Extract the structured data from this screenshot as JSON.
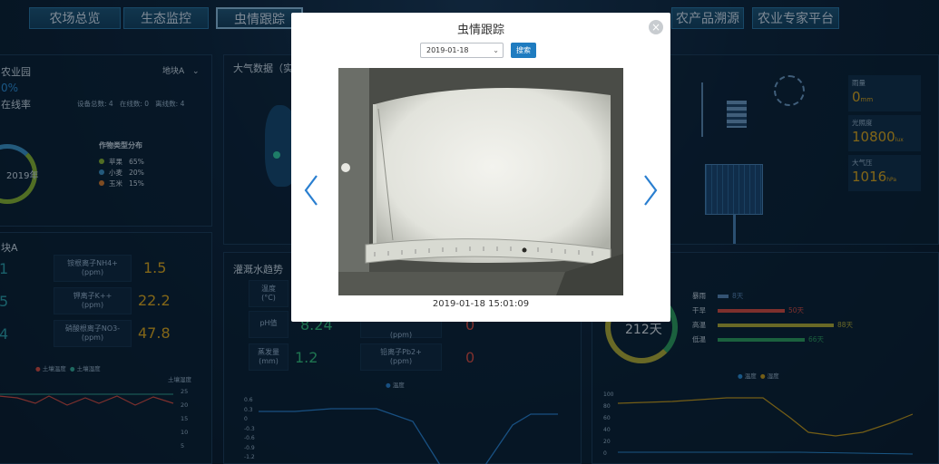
{
  "nav": {
    "left": [
      "农场总览",
      "生态监控",
      "虫情跟踪"
    ],
    "right": [
      "农产品溯源",
      "农业专家平台"
    ],
    "active_index": 2
  },
  "left_panel": {
    "title": "农业园",
    "block_selector": "地块A",
    "rate_value": "0%",
    "rate_label": "在线率",
    "stats": "设备总数: 4   在线数: 0   离线数: 4",
    "ring_label": "2019年",
    "crop_title": "作物类型分布",
    "crops": [
      {
        "name": "苹果",
        "pct": "65%",
        "color": "#8cbd3f"
      },
      {
        "name": "小麦",
        "pct": "20%",
        "color": "#3d9bd6"
      },
      {
        "name": "玉米",
        "pct": "15%",
        "color": "#d9843b"
      }
    ],
    "block_title": "块A",
    "ions": [
      {
        "label": "铵根离子NH4+\n(ppm)",
        "value": "1.5"
      },
      {
        "label": "钾离子K++\n(ppm)",
        "value": "22.2"
      },
      {
        "label": "硝酸根离子NO3-\n(ppm)",
        "value": "47.8"
      }
    ],
    "left_numbers": [
      "1",
      "5",
      "4"
    ],
    "legend": [
      "土壤温度",
      "土壤湿度"
    ],
    "y_axis_title": "土壤湿度",
    "y_ticks": [
      "25",
      "20",
      "15",
      "10",
      "5"
    ]
  },
  "middle": {
    "atmo_title": "大气数据（实",
    "irrig_title": "灌溉水趋势",
    "rows": [
      {
        "label": "温度\n(°C)",
        "value": ""
      },
      {
        "label": "pH值",
        "value": "8.24"
      },
      {
        "label": "蒸发量\n(mm)",
        "value": "1.2"
      }
    ],
    "rows_right": [
      {
        "label": "(ppm)",
        "value": "0"
      },
      {
        "label": "铅离子Pb2+\n(ppm)",
        "value": "0"
      }
    ],
    "legend": "温度",
    "y_ticks": [
      "0.6",
      "0.3",
      "0",
      "-0.3",
      "-0.6",
      "-0.9",
      "-1.2"
    ]
  },
  "right_panel": {
    "metrics": [
      {
        "label": "雨量",
        "value": "0",
        "unit": "mm"
      },
      {
        "label": "光照度",
        "value": "10800",
        "unit": "lux"
      },
      {
        "label": "大气压",
        "value": "1016",
        "unit": "hPa"
      }
    ],
    "ring_value": "212天",
    "weather": [
      {
        "label": "暴雨",
        "value": "8天",
        "color": "#5b8fc6"
      },
      {
        "label": "干旱",
        "value": "50天",
        "color": "#d9534f"
      },
      {
        "label": "高温",
        "value": "88天",
        "color": "#b6b543"
      },
      {
        "label": "低温",
        "value": "66天",
        "color": "#2fa86b"
      }
    ],
    "legend": [
      "温度",
      "湿度"
    ],
    "y_ticks": [
      "100",
      "80",
      "60",
      "40",
      "20",
      "0"
    ]
  },
  "modal": {
    "title": "虫情跟踪",
    "date_value": "2019-01-18",
    "search_label": "搜索",
    "caption": "2019-01-18 15:01:09",
    "close_glyph": "×",
    "colors": {
      "accent": "#1f7cc0",
      "arrow": "#2a7fd0"
    }
  }
}
